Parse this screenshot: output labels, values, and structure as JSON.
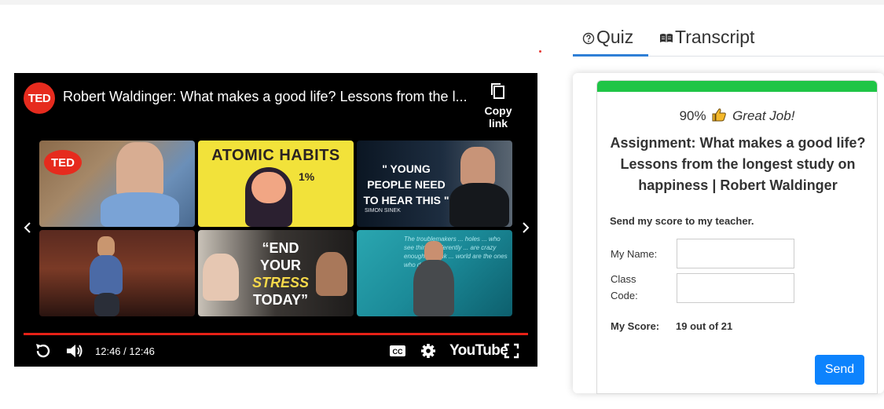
{
  "video": {
    "channel_logo": "TED",
    "title": "Robert Waldinger: What makes a good life? Lessons from the l...",
    "copy_link_label": "Copy link",
    "time": "12:46 / 12:46",
    "youtube_label": "YouTube",
    "progress": 1.0,
    "thumbnails": [
      {
        "badge": "TED"
      },
      {
        "title": "ATOMIC HABITS",
        "badge": "1%"
      },
      {
        "title": "\" YOUNG PEOPLE NEED TO HEAR THIS \"",
        "subtitle": "SIMON SINEK"
      },
      {},
      {
        "title_line1": "“END YOUR",
        "title_line2": "STRESS",
        "title_line3": "TODAY”"
      },
      {
        "caption": "The troublemakers ... holes ... who see things differently ... are crazy enough to think ... world are the ones who do."
      }
    ],
    "icons": [
      "replay-icon",
      "volume-icon",
      "cc-icon",
      "settings-icon",
      "fullscreen-icon",
      "chevron-left-icon",
      "chevron-right-icon",
      "copy-icon"
    ]
  },
  "tabs": {
    "quiz_label": "Quiz",
    "transcript_label": "Transcript",
    "active": "Quiz"
  },
  "quiz": {
    "score_percent": "90%",
    "praise": "Great Job!",
    "assignment_title": "Assignment: What makes a good life? Lessons from the longest study on happiness | Robert Waldinger",
    "send_note": "Send my score to my teacher.",
    "name_label": "My Name:",
    "name_value": "",
    "class_label": "Class Code:",
    "class_value": "",
    "my_score_label": "My Score:",
    "my_score_value": "19 out of 21",
    "send_button": "Send"
  },
  "colors": {
    "accent_green": "#1fc546",
    "button_blue": "#0d83fd",
    "tab_underline": "#2f7fd6",
    "progress_red": "#e62117",
    "ted_red": "#e62b1e"
  }
}
